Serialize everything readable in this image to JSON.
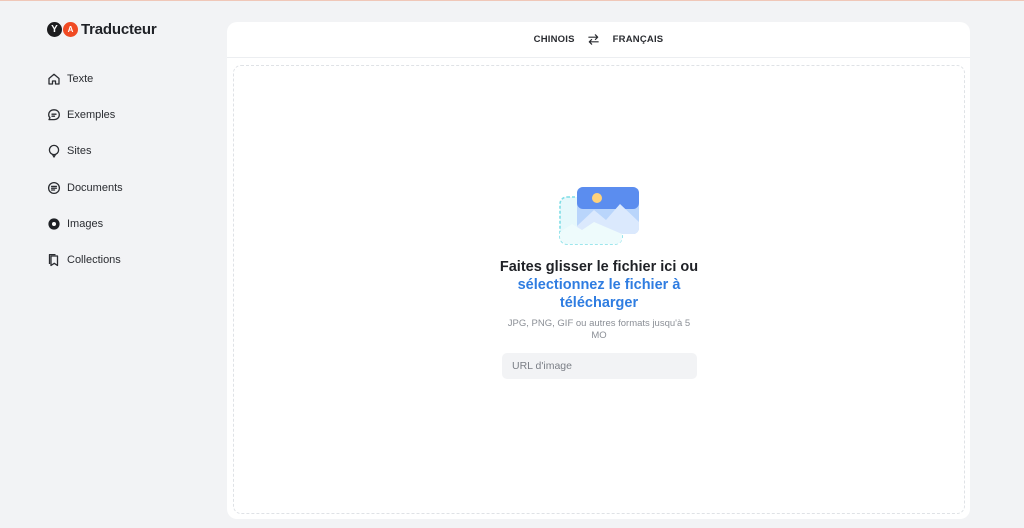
{
  "brand": {
    "name": "Traducteur",
    "badge_y": "Y",
    "badge_t": "A"
  },
  "sidebar": {
    "items": [
      {
        "label": "Texte",
        "icon": "home-icon",
        "active": false
      },
      {
        "label": "Exemples",
        "icon": "chat-bubble-icon",
        "active": false
      },
      {
        "label": "Sites",
        "icon": "globe-pin-icon",
        "active": false
      },
      {
        "label": "Documents",
        "icon": "document-icon",
        "active": false
      },
      {
        "label": "Images",
        "icon": "image-circle-icon",
        "active": true
      },
      {
        "label": "Collections",
        "icon": "bookmark-collection-icon",
        "active": false
      }
    ]
  },
  "language_bar": {
    "source": "CHINOIS",
    "target": "FRANÇAIS",
    "swap_icon": "swap-arrows-icon"
  },
  "dropzone": {
    "title_line": "Faites glisser le fichier ici ou",
    "link_text": "sélectionnez le fichier à télécharger",
    "hint": "JPG, PNG, GIF ou autres formats jusqu'à 5 MO",
    "url_placeholder": "URL d'image",
    "illustration": "image-upload-illustration"
  },
  "colors": {
    "accent": "#2f7de1",
    "brand_orange": "#f04a23",
    "background": "#f2f3f5",
    "panel": "#ffffff"
  }
}
